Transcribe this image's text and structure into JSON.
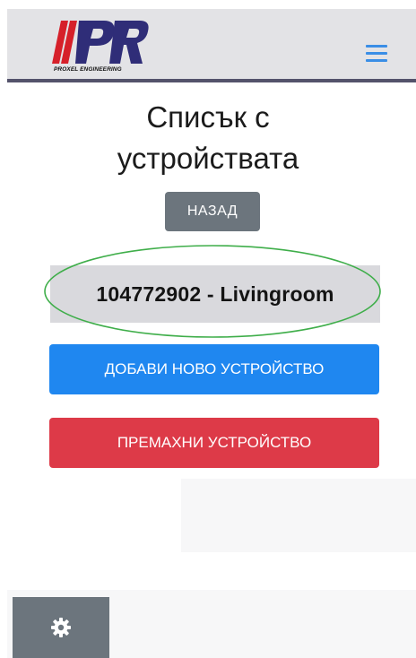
{
  "header": {
    "logo_text": "PR",
    "logo_subtitle": "PROXEL ENGINEERING",
    "menu_icon": "hamburger-menu-icon",
    "accent_color": "#3a8ee6"
  },
  "page": {
    "title_line1": "Списък с",
    "title_line2": "устройствата"
  },
  "buttons": {
    "back": "НАЗАД",
    "add_device": "ДОБАВИ НОВО УСТРОЙСТВО",
    "remove_device": "ПРЕМАХНИ УСТРОЙСТВО"
  },
  "devices": [
    {
      "label": "104772902 - Livingroom"
    }
  ],
  "footer": {
    "settings_icon": "gear-icon"
  },
  "colors": {
    "back_button": "#6c757d",
    "add_button": "#1f87f0",
    "remove_button": "#dd3a48",
    "highlight_ellipse": "#3fae4a"
  }
}
